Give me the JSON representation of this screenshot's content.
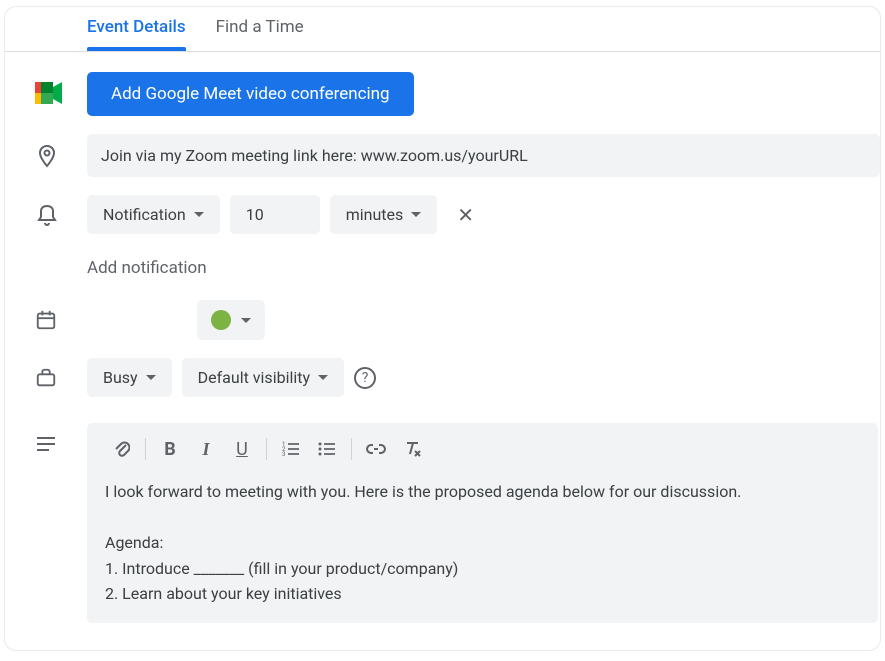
{
  "tabs": {
    "event_details": "Event Details",
    "find_time": "Find a Time"
  },
  "meet": {
    "button_label": "Add Google Meet video conferencing"
  },
  "location": {
    "value": "Join via my Zoom meeting link here: www.zoom.us/yourURL"
  },
  "notification": {
    "type_label": "Notification",
    "value": "10",
    "unit_label": "minutes",
    "add_label": "Add notification"
  },
  "calendar": {
    "color": "#7cb342"
  },
  "availability": {
    "busy_label": "Busy",
    "visibility_label": "Default visibility"
  },
  "description": {
    "text": "I look forward to meeting with you. Here is the proposed agenda below for our discussion.\n\nAgenda:\n1. Introduce _______ (fill in your product/company)\n2. Learn about your key initiatives"
  }
}
